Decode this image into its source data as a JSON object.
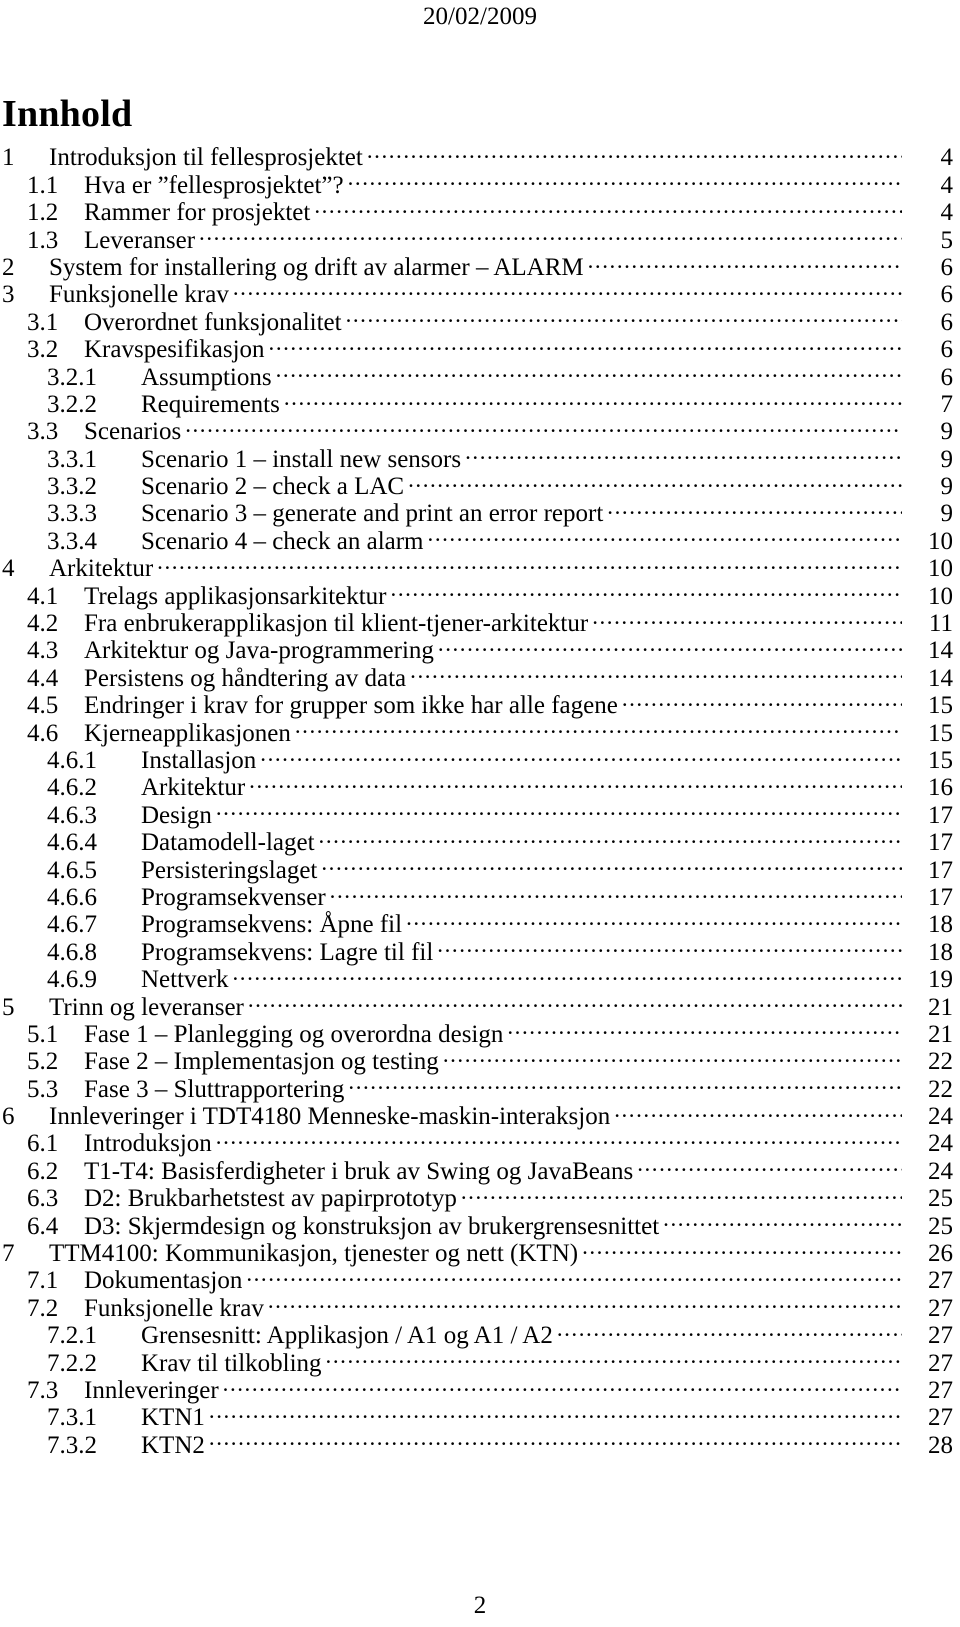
{
  "header": {
    "date": "20/02/2009"
  },
  "title": "Innhold",
  "footer": {
    "page_number": "2"
  },
  "toc": {
    "entries": [
      {
        "level": 1,
        "number": "1",
        "text": "Introduksjon til fellesprosjektet",
        "page": "4"
      },
      {
        "level": 2,
        "number": "1.1",
        "text": "Hva er ”fellesprosjektet”?",
        "page": "4"
      },
      {
        "level": 2,
        "number": "1.2",
        "text": "Rammer for prosjektet",
        "page": "4"
      },
      {
        "level": 2,
        "number": "1.3",
        "text": "Leveranser",
        "page": "5"
      },
      {
        "level": 1,
        "number": "2",
        "text": "System for installering og drift av alarmer – ALARM",
        "page": "6"
      },
      {
        "level": 1,
        "number": "3",
        "text": "Funksjonelle krav",
        "page": "6"
      },
      {
        "level": 2,
        "number": "3.1",
        "text": "Overordnet funksjonalitet",
        "page": "6"
      },
      {
        "level": 2,
        "number": "3.2",
        "text": "Kravspesifikasjon",
        "page": "6"
      },
      {
        "level": 3,
        "number": "3.2.1",
        "text": "Assumptions",
        "page": "6"
      },
      {
        "level": 3,
        "number": "3.2.2",
        "text": "Requirements",
        "page": "7"
      },
      {
        "level": 2,
        "number": "3.3",
        "text": "Scenarios",
        "page": "9"
      },
      {
        "level": 3,
        "number": "3.3.1",
        "text": "Scenario 1 – install new sensors",
        "page": "9"
      },
      {
        "level": 3,
        "number": "3.3.2",
        "text": "Scenario 2 – check a LAC",
        "page": "9"
      },
      {
        "level": 3,
        "number": "3.3.3",
        "text": "Scenario 3 – generate and print an error report",
        "page": "9"
      },
      {
        "level": 3,
        "number": "3.3.4",
        "text": "Scenario 4 – check an alarm",
        "page": "10"
      },
      {
        "level": 1,
        "number": "4",
        "text": "Arkitektur",
        "page": "10"
      },
      {
        "level": 2,
        "number": "4.1",
        "text": "Trelags applikasjonsarkitektur",
        "page": "10"
      },
      {
        "level": 2,
        "number": "4.2",
        "text": "Fra enbrukerapplikasjon til klient-tjener-arkitektur",
        "page": "11"
      },
      {
        "level": 2,
        "number": "4.3",
        "text": "Arkitektur og Java-programmering",
        "page": "14"
      },
      {
        "level": 2,
        "number": "4.4",
        "text": "Persistens og håndtering av data",
        "page": "14"
      },
      {
        "level": 2,
        "number": "4.5",
        "text": "Endringer i krav for grupper som ikke har alle fagene",
        "page": "15"
      },
      {
        "level": 2,
        "number": "4.6",
        "text": "Kjerneapplikasjonen",
        "page": "15"
      },
      {
        "level": 3,
        "number": "4.6.1",
        "text": "Installasjon",
        "page": "15"
      },
      {
        "level": 3,
        "number": "4.6.2",
        "text": "Arkitektur",
        "page": "16"
      },
      {
        "level": 3,
        "number": "4.6.3",
        "text": "Design",
        "page": "17"
      },
      {
        "level": 3,
        "number": "4.6.4",
        "text": "Datamodell-laget",
        "page": "17"
      },
      {
        "level": 3,
        "number": "4.6.5",
        "text": "Persisteringslaget",
        "page": "17"
      },
      {
        "level": 3,
        "number": "4.6.6",
        "text": "Programsekvenser",
        "page": "17"
      },
      {
        "level": 3,
        "number": "4.6.7",
        "text": "Programsekvens: Åpne fil",
        "page": "18"
      },
      {
        "level": 3,
        "number": "4.6.8",
        "text": "Programsekvens: Lagre til fil",
        "page": "18"
      },
      {
        "level": 3,
        "number": "4.6.9",
        "text": "Nettverk",
        "page": "19"
      },
      {
        "level": 1,
        "number": "5",
        "text": "Trinn og leveranser",
        "page": "21"
      },
      {
        "level": 2,
        "number": "5.1",
        "text": "Fase 1 – Planlegging og overordna design",
        "page": "21"
      },
      {
        "level": 2,
        "number": "5.2",
        "text": "Fase 2 – Implementasjon og testing",
        "page": "22"
      },
      {
        "level": 2,
        "number": "5.3",
        "text": "Fase 3 – Sluttrapportering",
        "page": "22"
      },
      {
        "level": 1,
        "number": "6",
        "text": "Innleveringer i TDT4180 Menneske-maskin-interaksjon",
        "page": "24"
      },
      {
        "level": 2,
        "number": "6.1",
        "text": "Introduksjon",
        "page": "24"
      },
      {
        "level": 2,
        "number": "6.2",
        "text": "T1-T4: Basisferdigheter i bruk av Swing og JavaBeans",
        "page": "24"
      },
      {
        "level": 2,
        "number": "6.3",
        "text": "D2: Brukbarhetstest av papirprototyp",
        "page": "25"
      },
      {
        "level": 2,
        "number": "6.4",
        "text": "D3: Skjermdesign og konstruksjon av brukergrensesnittet",
        "page": "25"
      },
      {
        "level": 1,
        "number": "7",
        "text": "TTM4100: Kommunikasjon, tjenester og nett (KTN)",
        "page": "26"
      },
      {
        "level": 2,
        "number": "7.1",
        "text": "Dokumentasjon",
        "page": "27"
      },
      {
        "level": 2,
        "number": "7.2",
        "text": "Funksjonelle krav",
        "page": "27"
      },
      {
        "level": 3,
        "number": "7.2.1",
        "text": "Grensesnitt: Applikasjon / A1 og A1 / A2",
        "page": "27"
      },
      {
        "level": 3,
        "number": "7.2.2",
        "text": "Krav til tilkobling",
        "page": "27"
      },
      {
        "level": 2,
        "number": "7.3",
        "text": "Innleveringer",
        "page": "27"
      },
      {
        "level": 3,
        "number": "7.3.1",
        "text": "KTN1",
        "page": "27"
      },
      {
        "level": 3,
        "number": "7.3.2",
        "text": "KTN2",
        "page": "28"
      }
    ]
  }
}
